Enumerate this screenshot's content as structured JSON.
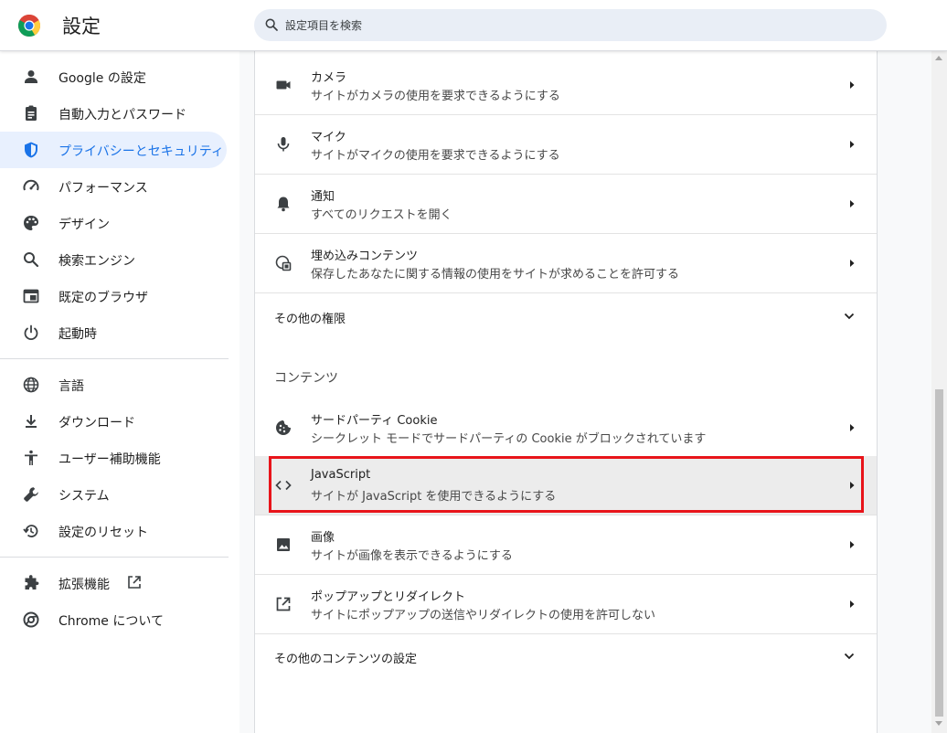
{
  "app": {
    "title": "設定"
  },
  "search": {
    "placeholder": "設定項目を検索"
  },
  "colors": {
    "accent": "#1a73e8",
    "active_bg": "#e8f0fe",
    "highlight_border": "#e8141a"
  },
  "sidebar": {
    "items": [
      {
        "label": "Google の設定",
        "icon": "person-icon"
      },
      {
        "label": "自動入力とパスワード",
        "icon": "clipboard-icon"
      },
      {
        "label": "プライバシーとセキュリティ",
        "icon": "shield-icon",
        "active": true
      },
      {
        "label": "パフォーマンス",
        "icon": "speedometer-icon"
      },
      {
        "label": "デザイン",
        "icon": "palette-icon"
      },
      {
        "label": "検索エンジン",
        "icon": "search-icon"
      },
      {
        "label": "既定のブラウザ",
        "icon": "browser-icon"
      },
      {
        "label": "起動時",
        "icon": "power-icon"
      },
      {
        "label": "言語",
        "icon": "globe-icon"
      },
      {
        "label": "ダウンロード",
        "icon": "download-icon"
      },
      {
        "label": "ユーザー補助機能",
        "icon": "accessibility-icon"
      },
      {
        "label": "システム",
        "icon": "wrench-icon"
      },
      {
        "label": "設定のリセット",
        "icon": "reset-icon"
      },
      {
        "label": "拡張機能",
        "icon": "puzzle-icon"
      },
      {
        "label": "Chrome について",
        "icon": "chrome-icon"
      }
    ]
  },
  "permissions": {
    "rows": [
      {
        "title": "カメラ",
        "subtitle": "サイトがカメラの使用を要求できるようにする",
        "icon": "camera-icon"
      },
      {
        "title": "マイク",
        "subtitle": "サイトがマイクの使用を要求できるようにする",
        "icon": "mic-icon"
      },
      {
        "title": "通知",
        "subtitle": "すべてのリクエストを開く",
        "icon": "bell-icon"
      },
      {
        "title": "埋め込みコンテンツ",
        "subtitle": "保存したあなたに関する情報の使用をサイトが求めることを許可する",
        "icon": "embedded-content-icon"
      }
    ],
    "more_label": "その他の権限"
  },
  "content": {
    "heading": "コンテンツ",
    "rows": [
      {
        "title": "サードパーティ Cookie",
        "subtitle": "シークレット モードでサードパーティの Cookie がブロックされています",
        "icon": "cookie-icon"
      },
      {
        "title": "JavaScript",
        "subtitle": "サイトが JavaScript を使用できるようにする",
        "icon": "code-icon",
        "highlighted": true
      },
      {
        "title": "画像",
        "subtitle": "サイトが画像を表示できるようにする",
        "icon": "image-icon"
      },
      {
        "title": "ポップアップとリダイレクト",
        "subtitle": "サイトにポップアップの送信やリダイレクトの使用を許可しない",
        "icon": "open-external-icon"
      }
    ],
    "more_label": "その他のコンテンツの設定"
  }
}
